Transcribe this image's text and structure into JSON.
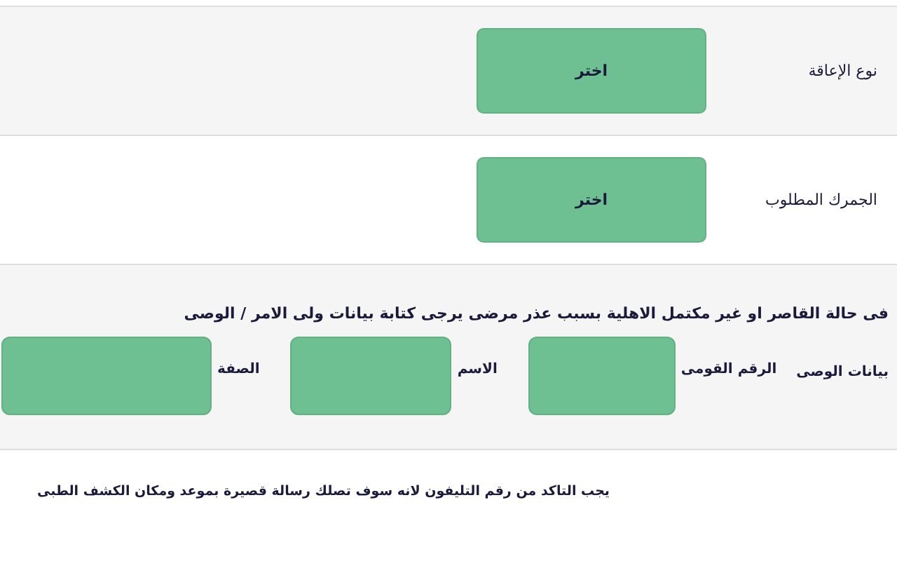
{
  "select_rows": [
    {
      "label": "نوع الإعاقة",
      "button": "اختر"
    },
    {
      "label": "الجمرك المطلوب",
      "button": "اختر"
    }
  ],
  "guardian": {
    "note": "فى حالة القاصر او غير مكتمل الاهلية بسبب عذر مرضى يرجى كتابة بيانات ولى الامر / الوصى",
    "title": "بيانات الوصى",
    "fields": [
      {
        "label": "الرقم القومى"
      },
      {
        "label": "الاسم"
      },
      {
        "label": "الصفة"
      }
    ]
  },
  "phone_note": "يجب التاكد من رقم التليفون لانه سوف تصلك رسالة قصيرة بموعد ومكان الكشف الطبى"
}
